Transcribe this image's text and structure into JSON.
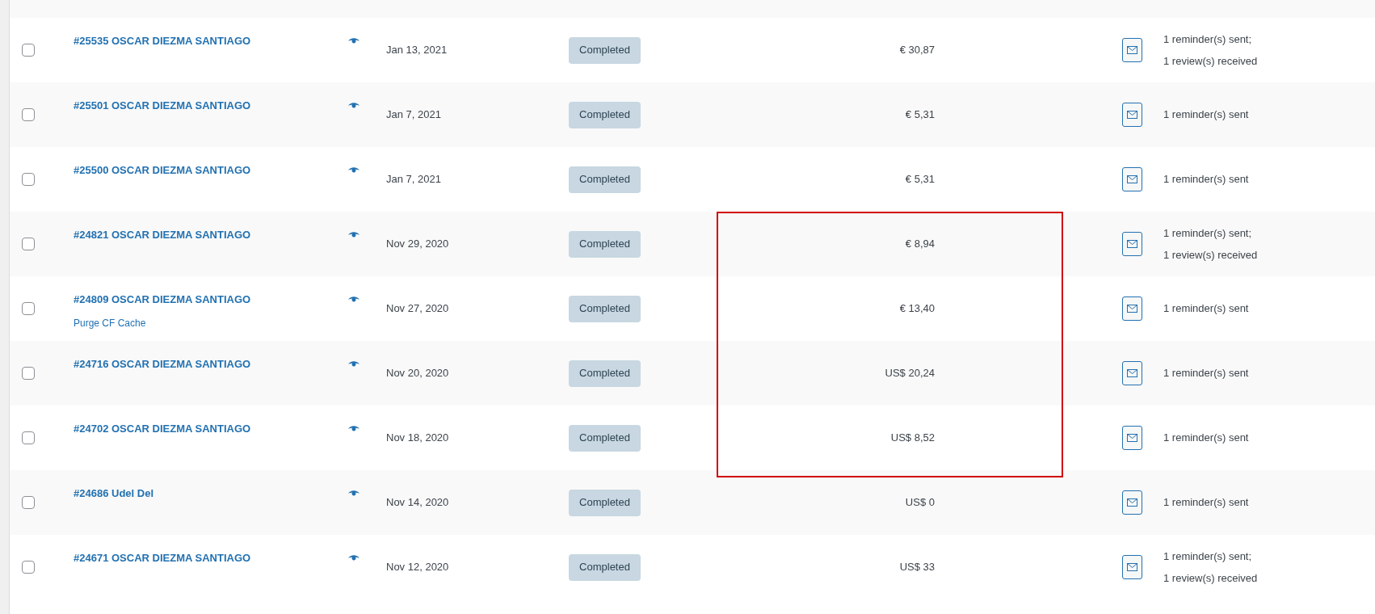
{
  "orders": [
    {
      "order": "#25535 OSCAR DIEZMA SANTIAGO",
      "selected": false,
      "date": "Jan 13, 2021",
      "status": "Completed",
      "total": "€ 30,87",
      "notes": [
        "1 reminder(s) sent;",
        "1 review(s) received"
      ]
    },
    {
      "order": "#25501 OSCAR DIEZMA SANTIAGO",
      "selected": false,
      "date": "Jan 7, 2021",
      "status": "Completed",
      "total": "€ 5,31",
      "notes": [
        "1 reminder(s) sent"
      ]
    },
    {
      "order": "#25500 OSCAR DIEZMA SANTIAGO",
      "selected": false,
      "date": "Jan 7, 2021",
      "status": "Completed",
      "total": "€ 5,31",
      "notes": [
        "1 reminder(s) sent"
      ]
    },
    {
      "order": "#24821 OSCAR DIEZMA SANTIAGO",
      "selected": false,
      "date": "Nov 29, 2020",
      "status": "Completed",
      "total": "€ 8,94",
      "notes": [
        "1 reminder(s) sent;",
        "1 review(s) received"
      ]
    },
    {
      "order": "#24809 OSCAR DIEZMA SANTIAGO",
      "selected": false,
      "date": "Nov 27, 2020",
      "status": "Completed",
      "total": "€ 13,40",
      "notes": [
        "1 reminder(s) sent"
      ],
      "actions": [
        "Purge CF Cache"
      ]
    },
    {
      "order": "#24716 OSCAR DIEZMA SANTIAGO",
      "selected": false,
      "date": "Nov 20, 2020",
      "status": "Completed",
      "total": "US$ 20,24",
      "notes": [
        "1 reminder(s) sent"
      ]
    },
    {
      "order": "#24702 OSCAR DIEZMA SANTIAGO",
      "selected": false,
      "date": "Nov 18, 2020",
      "status": "Completed",
      "total": "US$ 8,52",
      "notes": [
        "1 reminder(s) sent"
      ]
    },
    {
      "order": "#24686 Udel Del",
      "selected": false,
      "date": "Nov 14, 2020",
      "status": "Completed",
      "total": "US$ 0",
      "notes": [
        "1 reminder(s) sent"
      ]
    },
    {
      "order": "#24671 OSCAR DIEZMA SANTIAGO",
      "selected": false,
      "date": "Nov 12, 2020",
      "status": "Completed",
      "total": "US$ 33",
      "notes": [
        "1 reminder(s) sent;",
        "1 review(s) received"
      ]
    }
  ]
}
